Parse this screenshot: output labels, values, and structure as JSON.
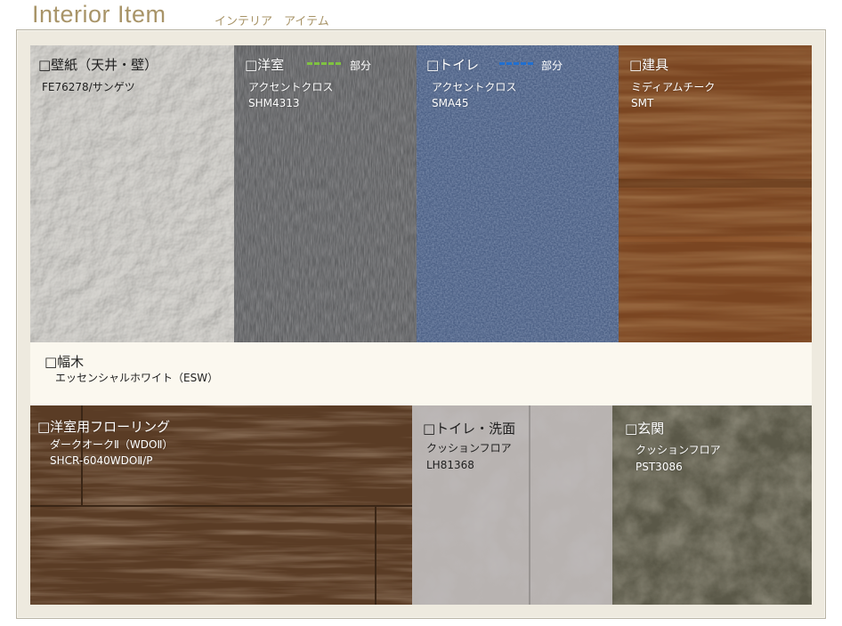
{
  "header": {
    "title_en": "Interior Item",
    "title_ja": "インテリア　アイテム"
  },
  "panels": {
    "wall": {
      "heading": "□壁紙（天井・壁）",
      "code": "FE76278/サンゲツ"
    },
    "western_room": {
      "heading": "□洋室",
      "legend_label": "部分",
      "name": "アクセントクロス",
      "code": "SHM4313",
      "legend_color": "#7fc241"
    },
    "toilet": {
      "heading": "□トイレ",
      "legend_label": "部分",
      "name": "アクセントクロス",
      "code": "SMA45",
      "legend_color": "#1f6fd1"
    },
    "fittings": {
      "heading": "□建具",
      "name": "ミディアムチーク",
      "code": "SMT"
    },
    "baseboard": {
      "heading": "□幅木",
      "name": "エッセンシャルホワイト（ESW）"
    },
    "flooring": {
      "heading": "□洋室用フローリング",
      "name": "ダークオークⅡ（WDOⅡ）",
      "code": "SHCR-6040WDOⅡ/P"
    },
    "toilet_wash": {
      "heading": "□トイレ・洗面",
      "name": "クッションフロア",
      "code": "LH81368"
    },
    "entrance": {
      "heading": "□玄関",
      "name": "クッションフロア",
      "code": "PST3086"
    }
  },
  "colors": {
    "title": "#a89468",
    "board": "#eeeadf"
  }
}
